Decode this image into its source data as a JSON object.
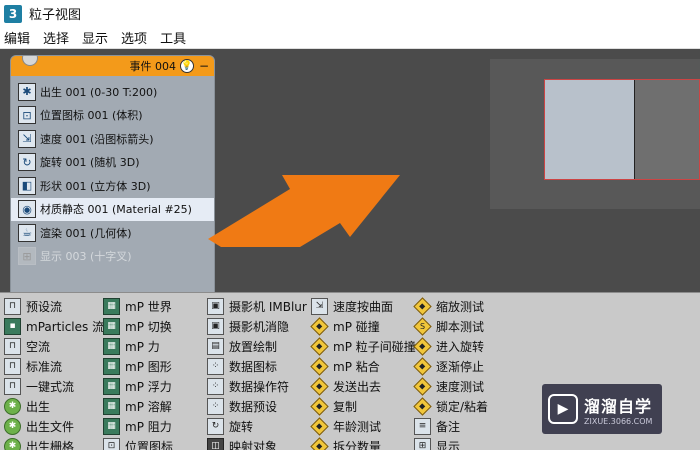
{
  "window": {
    "icon_text": "3",
    "title": "粒子视图"
  },
  "menu": [
    "编辑",
    "选择",
    "显示",
    "选项",
    "工具"
  ],
  "event": {
    "title": "事件 004",
    "bulb_icon": "lightbulb-icon",
    "minimize": "−",
    "operators": [
      {
        "label": "出生 001 (0-30 T:200)",
        "icon": "birth-icon",
        "glyph": "✱"
      },
      {
        "label": "位置图标 001 (体积)",
        "icon": "position-icon-icon",
        "glyph": "⊡"
      },
      {
        "label": "速度 001 (沿图标箭头)",
        "icon": "speed-icon",
        "glyph": "⇲"
      },
      {
        "label": "旋转 001 (随机 3D)",
        "icon": "rotation-icon",
        "glyph": "↻"
      },
      {
        "label": "形状 001 (立方体 3D)",
        "icon": "shape-icon",
        "glyph": "◧"
      },
      {
        "label": "材质静态 001 (Material #25)",
        "icon": "material-static-icon",
        "glyph": "◉",
        "selected": true
      },
      {
        "label": "渲染 001 (几何体)",
        "icon": "render-icon",
        "glyph": "☕"
      },
      {
        "label": "显示 003 (十字叉)",
        "icon": "display-icon",
        "glyph": "⊞",
        "disabled": true
      }
    ]
  },
  "arrow_color": "#f07a14",
  "depot": {
    "columns": [
      [
        {
          "label": "预设流",
          "icon": "preset-flow-icon",
          "style": "",
          "glyph": "⊓"
        },
        {
          "label": "mParticles 流",
          "icon": "mparticles-flow-icon",
          "style": "teal",
          "glyph": "▪"
        },
        {
          "label": "空流",
          "icon": "empty-flow-icon",
          "style": "",
          "glyph": "⊓"
        },
        {
          "label": "标准流",
          "icon": "standard-flow-icon",
          "style": "",
          "glyph": "⊓"
        },
        {
          "label": "一键式流",
          "icon": "one-click-flow-icon",
          "style": "",
          "glyph": "⊓"
        },
        {
          "label": "出生",
          "icon": "birth-icon",
          "style": "green",
          "glyph": "✱"
        },
        {
          "label": "出生文件",
          "icon": "birth-file-icon",
          "style": "green",
          "glyph": "✱"
        },
        {
          "label": "出生栅格",
          "icon": "birth-grid-icon",
          "style": "green",
          "glyph": "✱"
        }
      ],
      [
        {
          "label": "mP 世界",
          "icon": "mp-world-icon",
          "style": "teal",
          "glyph": "▦"
        },
        {
          "label": "mP 切换",
          "icon": "mp-switch-icon",
          "style": "teal",
          "glyph": "▦"
        },
        {
          "label": "mP 力",
          "icon": "mp-force-icon",
          "style": "teal",
          "glyph": "▦"
        },
        {
          "label": "mP 图形",
          "icon": "mp-shape-icon",
          "style": "teal",
          "glyph": "▦"
        },
        {
          "label": "mP 浮力",
          "icon": "mp-buoyancy-icon",
          "style": "teal",
          "glyph": "▦"
        },
        {
          "label": "mP 溶解",
          "icon": "mp-solvent-icon",
          "style": "teal",
          "glyph": "▦"
        },
        {
          "label": "mP 阻力",
          "icon": "mp-drag-icon",
          "style": "teal",
          "glyph": "▦"
        },
        {
          "label": "位置图标",
          "icon": "position-icon-icon",
          "style": "",
          "glyph": "⊡"
        }
      ],
      [
        {
          "label": "摄影机 IMBlur",
          "icon": "camera-imblur-icon",
          "style": "",
          "glyph": "▣"
        },
        {
          "label": "摄影机消隐",
          "icon": "camera-culling-icon",
          "style": "",
          "glyph": "▣"
        },
        {
          "label": "放置绘制",
          "icon": "placement-paint-icon",
          "style": "",
          "glyph": "▤"
        },
        {
          "label": "数据图标",
          "icon": "data-icon-icon",
          "style": "",
          "glyph": "⁘"
        },
        {
          "label": "数据操作符",
          "icon": "data-operator-icon",
          "style": "",
          "glyph": "⁘"
        },
        {
          "label": "数据预设",
          "icon": "data-preset-icon",
          "style": "",
          "glyph": "⁘"
        },
        {
          "label": "旋转",
          "icon": "rotation-icon",
          "style": "",
          "glyph": "↻"
        },
        {
          "label": "映射对象",
          "icon": "mapping-object-icon",
          "style": "dark",
          "glyph": "◫"
        }
      ],
      [
        {
          "label": "速度按曲面",
          "icon": "speed-by-surface-icon",
          "style": "",
          "glyph": "⇲"
        },
        {
          "label": "mP 碰撞",
          "icon": "mp-collision-icon",
          "style": "diamond",
          "glyph": "◆"
        },
        {
          "label": "mP 粒子间碰撞",
          "icon": "mp-inter-collision-icon",
          "style": "diamond",
          "glyph": "◆"
        },
        {
          "label": "mP 粘合",
          "icon": "mp-glue-icon",
          "style": "diamond",
          "glyph": "◆"
        },
        {
          "label": "发送出去",
          "icon": "send-out-icon",
          "style": "diamond",
          "glyph": "◆"
        },
        {
          "label": "复制",
          "icon": "spawn-icon",
          "style": "diamond",
          "glyph": "◆"
        },
        {
          "label": "年龄测试",
          "icon": "age-test-icon",
          "style": "diamond",
          "glyph": "◆"
        },
        {
          "label": "拆分数量",
          "icon": "split-amount-icon",
          "style": "diamond",
          "glyph": "◆"
        }
      ],
      [
        {
          "label": "缩放测试",
          "icon": "scale-test-icon",
          "style": "diamond",
          "glyph": "◆"
        },
        {
          "label": "脚本测试",
          "icon": "script-test-icon",
          "style": "diamond",
          "glyph": "S"
        },
        {
          "label": "进入旋转",
          "icon": "go-to-rotation-icon",
          "style": "diamond",
          "glyph": "◆"
        },
        {
          "label": "逐渐停止",
          "icon": "speed-by-stop-icon",
          "style": "diamond",
          "glyph": "◆"
        },
        {
          "label": "速度测试",
          "icon": "speed-test-icon",
          "style": "diamond",
          "glyph": "◆"
        },
        {
          "label": "锁定/粘着",
          "icon": "lock-bond-icon",
          "style": "diamond",
          "glyph": "◆"
        },
        {
          "label": "备注",
          "icon": "note-icon",
          "style": "",
          "glyph": "≡"
        },
        {
          "label": "显示",
          "icon": "display-icon",
          "style": "",
          "glyph": "⊞"
        }
      ]
    ]
  },
  "watermark": {
    "title": "溜溜自学",
    "url": "ZIXUE.3066.COM",
    "logo_glyph": "▶"
  }
}
